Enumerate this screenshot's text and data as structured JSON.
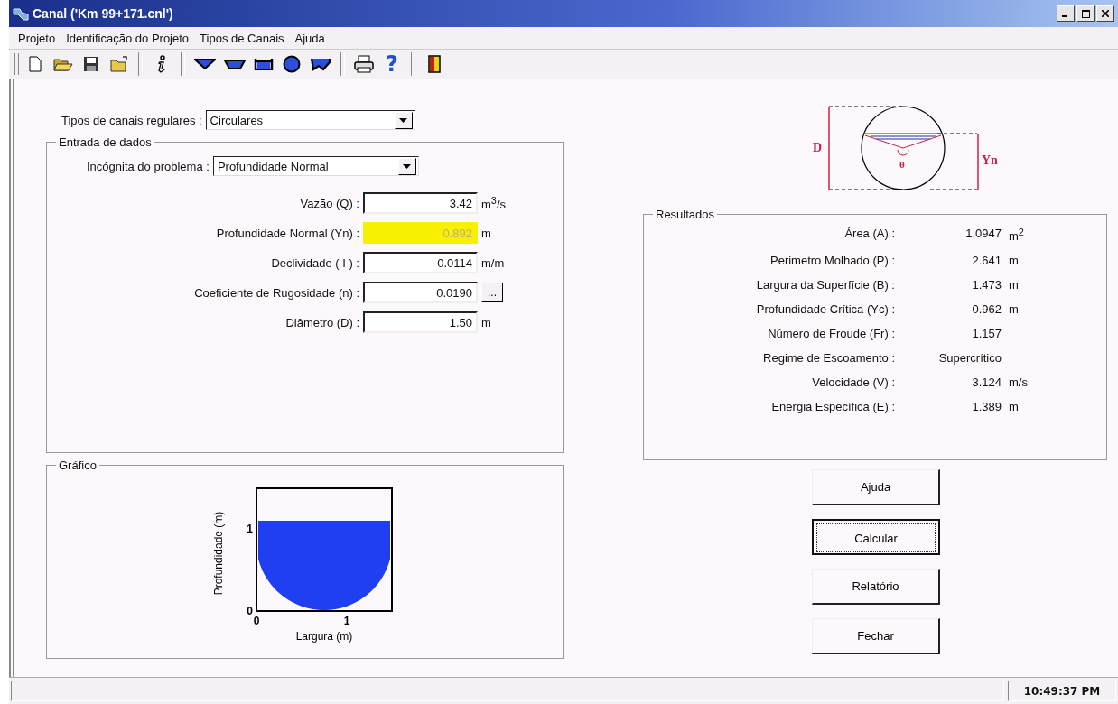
{
  "window": {
    "title": "Canal ('Km 99+171.cnl')"
  },
  "menu": [
    "Projeto",
    "Identificação do Projeto",
    "Tipos de Canais",
    "Ajuda"
  ],
  "toolbar": [
    {
      "kind": "new"
    },
    {
      "kind": "open"
    },
    {
      "kind": "save"
    },
    {
      "kind": "export"
    },
    {
      "kind": "separator"
    },
    {
      "kind": "info"
    },
    {
      "kind": "separator"
    },
    {
      "kind": "triangle"
    },
    {
      "kind": "trapezoid"
    },
    {
      "kind": "rectangle"
    },
    {
      "kind": "circle"
    },
    {
      "kind": "irregular"
    },
    {
      "kind": "separator"
    },
    {
      "kind": "printer"
    },
    {
      "kind": "help",
      "glyph": "?"
    },
    {
      "kind": "separator"
    },
    {
      "kind": "exit"
    }
  ],
  "channel_type": {
    "label": "Tipos de canais regulares :",
    "value": "Circulares"
  },
  "input_group": {
    "title": "Entrada de dados",
    "unknown": {
      "label": "Incógnita do problema :",
      "value": "Profundidade Normal"
    },
    "fields": [
      {
        "label": "Vazão (Q) :",
        "value": "3.42",
        "unit": "m$^{3}$/s",
        "computed": false,
        "kind": "unit"
      },
      {
        "label": "Profundidade Normal (Yn) :",
        "value": "0.892",
        "unit": "m",
        "computed": true,
        "kind": "unit"
      },
      {
        "label": "Declividade ( I ) :",
        "value": "0.0114",
        "unit": "m/m",
        "computed": false,
        "kind": "unit"
      },
      {
        "label": "Coeficiente de Rugosidade (n) :",
        "value": "0.0190",
        "unit": "...",
        "computed": false,
        "kind": "browse"
      },
      {
        "label": "Diâmetro (D) :",
        "value": "1.50",
        "unit": "m",
        "computed": false,
        "kind": "unit"
      }
    ]
  },
  "graph_group": {
    "title": "Gráfico",
    "xlabel": "Largura (m)",
    "ylabel": "Profundidade (m)",
    "xticks": [
      "0",
      "1"
    ],
    "yticks": [
      "1",
      "0"
    ]
  },
  "diagram": {
    "diameter_label": "D",
    "depth_label": "Yn",
    "angle_label": "θ"
  },
  "results": {
    "title": "Resultados",
    "rows": [
      {
        "label": "Área (A) :",
        "value": "1.0947",
        "unit": "m$^{2}$"
      },
      {
        "label": "Perimetro Molhado (P) :",
        "value": "2.641",
        "unit": "m"
      },
      {
        "label": "Largura da Superfície (B) :",
        "value": "1.473",
        "unit": "m"
      },
      {
        "label": "Profundidade Crítica (Yc) :",
        "value": "0.962",
        "unit": "m"
      },
      {
        "label": "Número de Froude (Fr) :",
        "value": "1.157"
      },
      {
        "label": "Regime de Escoamento :",
        "value": "Supercrítico"
      },
      {
        "label": "Velocidade (V) :",
        "value": "3.124",
        "unit": "m/s"
      },
      {
        "label": "Energia Específica (E) :",
        "value": "1.389",
        "unit": "m"
      }
    ]
  },
  "buttons": [
    {
      "label": "Ajuda",
      "focused": false
    },
    {
      "label": "Calcular",
      "focused": true
    },
    {
      "label": "Relatório",
      "focused": false
    },
    {
      "label": "Fechar",
      "focused": false
    }
  ],
  "status_bar": {
    "time": "10:49:37 PM"
  }
}
